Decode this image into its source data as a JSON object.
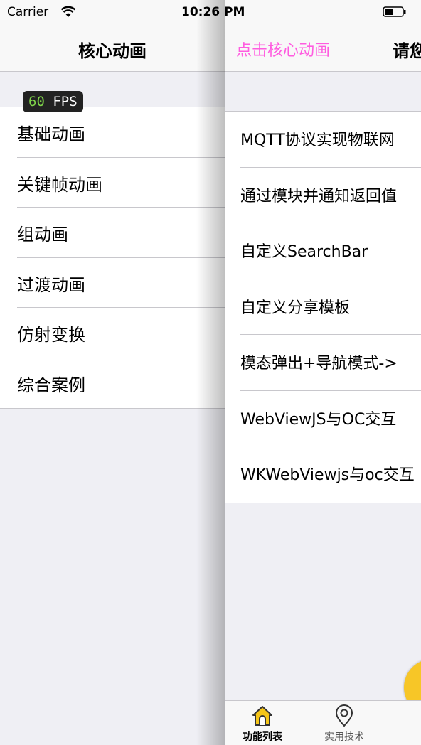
{
  "status_bar": {
    "carrier": "Carrier",
    "time": "10:26 PM"
  },
  "fps": {
    "value": "60",
    "unit": "FPS"
  },
  "left_screen": {
    "title": "核心动画",
    "items": [
      {
        "label": "基础动画"
      },
      {
        "label": "关键帧动画"
      },
      {
        "label": "组动画"
      },
      {
        "label": "过渡动画"
      },
      {
        "label": "仿射变换"
      },
      {
        "label": "综合案例"
      }
    ]
  },
  "right_screen": {
    "nav_left": "点击核心动画",
    "title_partial": "请您",
    "items": [
      {
        "label": "MQTT协议实现物联网"
      },
      {
        "label": "通过模块并通知返回值"
      },
      {
        "label": "自定义SearchBar"
      },
      {
        "label": "自定义分享模板"
      },
      {
        "label": "模态弹出+导航模式->"
      },
      {
        "label": "WebViewJS与OC交互"
      },
      {
        "label": "WKWebViewjs与oc交互"
      }
    ],
    "tabs": [
      {
        "label": "功能列表",
        "icon": "home-icon",
        "selected": true
      },
      {
        "label": "实用技术",
        "icon": "location-pin-icon",
        "selected": false
      }
    ],
    "accent_color": "#ff5ce0",
    "tab_icon_color": "#f5c518"
  }
}
